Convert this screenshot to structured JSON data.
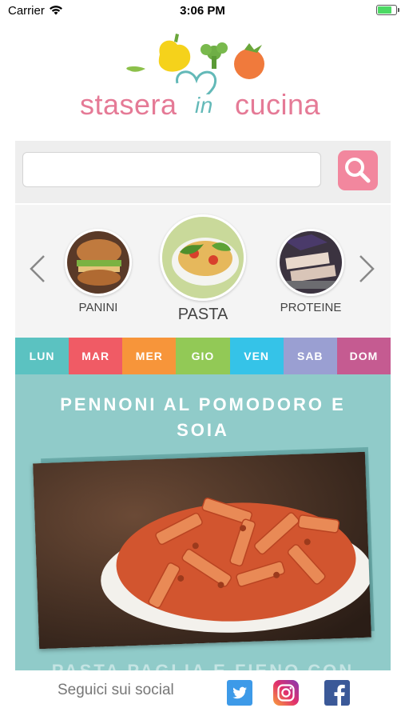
{
  "status_bar": {
    "carrier": "Carrier",
    "time": "3:06 PM"
  },
  "logo": {
    "part1": "stasera",
    "part2": "in",
    "part3": "cucina"
  },
  "search": {
    "value": "",
    "placeholder": ""
  },
  "categories": [
    {
      "label": "PANINI"
    },
    {
      "label": "PASTA"
    },
    {
      "label": "PROTEINE"
    }
  ],
  "days": [
    {
      "label": "LUN",
      "color": "#5bc2c1"
    },
    {
      "label": "MAR",
      "color": "#f05b65"
    },
    {
      "label": "MER",
      "color": "#f7953a"
    },
    {
      "label": "GIO",
      "color": "#92c956"
    },
    {
      "label": "VEN",
      "color": "#35c3e8"
    },
    {
      "label": "SAB",
      "color": "#9a9fd2"
    },
    {
      "label": "DOM",
      "color": "#c55b91"
    }
  ],
  "recipe": {
    "title": "PENNONI AL POMODORO E SOIA",
    "next_title": "PASTA PAGLIA E FIENO CON"
  },
  "footer": {
    "social_label": "Seguici sui social"
  },
  "colors": {
    "accent_pink": "#f2879e",
    "recipe_bg": "#90cbc9",
    "logo_pink": "#e57a96",
    "logo_teal": "#63b9b8"
  },
  "icons": [
    "wifi-icon",
    "battery-icon",
    "search-icon",
    "chevron-left-icon",
    "chevron-right-icon",
    "twitter-icon",
    "instagram-icon",
    "facebook-icon"
  ]
}
